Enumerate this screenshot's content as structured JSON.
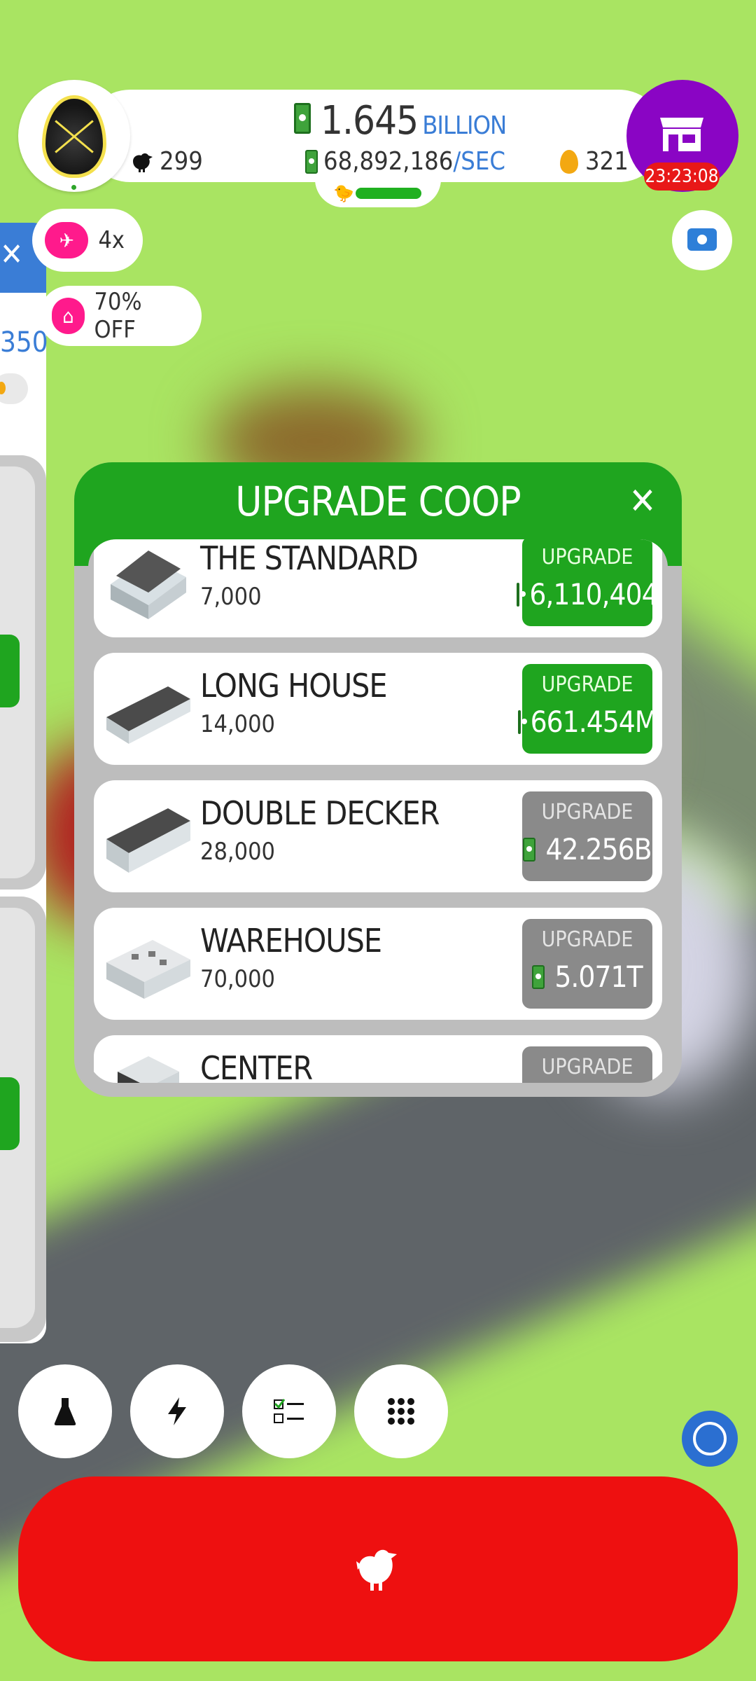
{
  "header": {
    "money_value": "1.645",
    "money_unit": "BILLION",
    "rate_value": "68,892,186",
    "rate_unit": "/SEC",
    "chicken_count": "299",
    "golden_eggs": "321",
    "shop_timer": "23:23:08"
  },
  "chips": {
    "drone_multiplier": "4x",
    "discount": "70% OFF"
  },
  "side": {
    "partial_number": "350"
  },
  "modal": {
    "title": "UPGRADE COOP",
    "close_label": "✕",
    "upgrade_label": "UPGRADE",
    "rows": [
      {
        "name": "THE STANDARD",
        "capacity": "7,000",
        "price": "6,110,404",
        "state": "available"
      },
      {
        "name": "LONG HOUSE",
        "capacity": "14,000",
        "price": "661.454M",
        "state": "available"
      },
      {
        "name": "DOUBLE DECKER",
        "capacity": "28,000",
        "price": "42.256B",
        "state": "locked"
      },
      {
        "name": "WAREHOUSE",
        "capacity": "70,000",
        "price": "5.071T",
        "state": "locked"
      },
      {
        "name": "CENTER",
        "capacity": "",
        "price": "",
        "state": "locked"
      }
    ]
  },
  "toolbar": {
    "icons": [
      "flask-icon",
      "lightning-icon",
      "checklist-icon",
      "grid-menu-icon"
    ]
  },
  "colors": {
    "grass": "#a9e462",
    "accent_green": "#1fa51f",
    "shop_purple": "#8a05c4",
    "hatch_red": "#ee1010",
    "locked_gray": "#8a8a8a",
    "link_blue": "#3a7dd6"
  }
}
